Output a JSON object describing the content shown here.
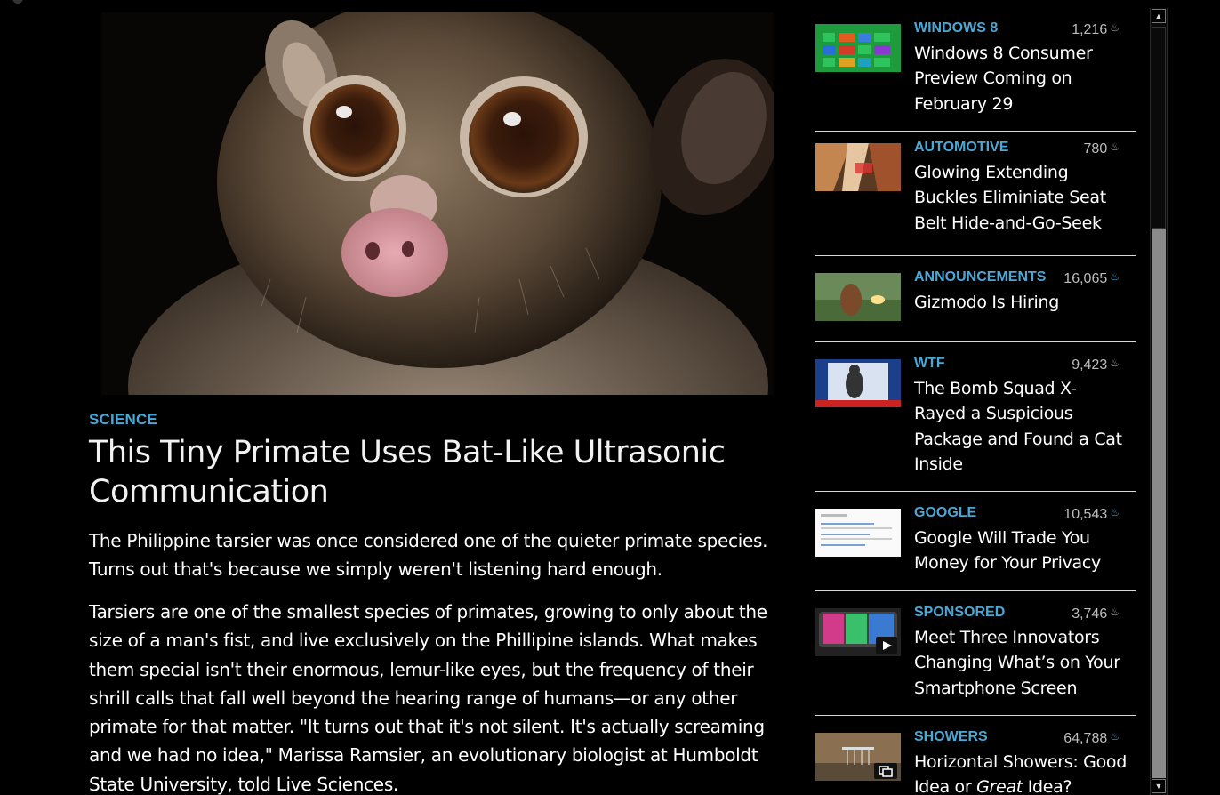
{
  "article": {
    "category": "SCIENCE",
    "title": "This Tiny Primate Uses Bat-Like Ultrasonic Communication",
    "deck": "The Philippine tarsier was once considered one of the quieter primate species. Turns out that's because we simply weren't listening hard enough.",
    "body": "Tarsiers are one of the smallest species of primates, growing to only about the size of a man's fist, and live exclusively on the Phillipine islands. What makes them special isn't their enormous, lemur-like eyes, but the frequency of their shrill calls that fall well beyond the hearing range of humans—or any other primate for that matter. \"It turns out that it's not silent. It's actually screaming and we had no idea,\" Marissa Ramsier, an evolutionary biologist at Humboldt State University, told Live Sciences."
  },
  "sidebar": {
    "items": [
      {
        "category": "WINDOWS 8",
        "count": "1,216",
        "flame": "gray-flame-icon",
        "title": "Windows 8 Consumer Preview Coming on February 29"
      },
      {
        "category": "AUTOMOTIVE",
        "count": "780",
        "flame": "gray-flame-icon",
        "title": "Glowing Extending Buckles Eliminiate Seat Belt Hide-and-Go-Seek"
      },
      {
        "category": "ANNOUNCEMENTS",
        "count": "16,065",
        "flame": "blue-flame-icon",
        "title": "Gizmodo Is Hiring"
      },
      {
        "category": "WTF",
        "count": "9,423",
        "flame": "gray-flame-icon",
        "title": "The Bomb Squad X-Rayed a Suspicious Package and Found a Cat Inside"
      },
      {
        "category": "GOOGLE",
        "count": "10,543",
        "flame": "blue-flame-icon",
        "title": "Google Will Trade You Money for Your Privacy"
      },
      {
        "category": "SPONSORED",
        "count": "3,746",
        "flame": "gray-flame-icon",
        "title": "Meet Three Innovators Changing What’s on Your Smartphone Screen"
      },
      {
        "category": "SHOWERS",
        "count": "64,788",
        "flame": "blue-flame-icon",
        "title_before": "Horizontal Showers: Good Idea or ",
        "title_em": "Great",
        "title_after": " Idea?"
      }
    ]
  },
  "colors": {
    "background": "#000000",
    "accent": "#4aa8d6",
    "divider": "#d8d8d8"
  }
}
